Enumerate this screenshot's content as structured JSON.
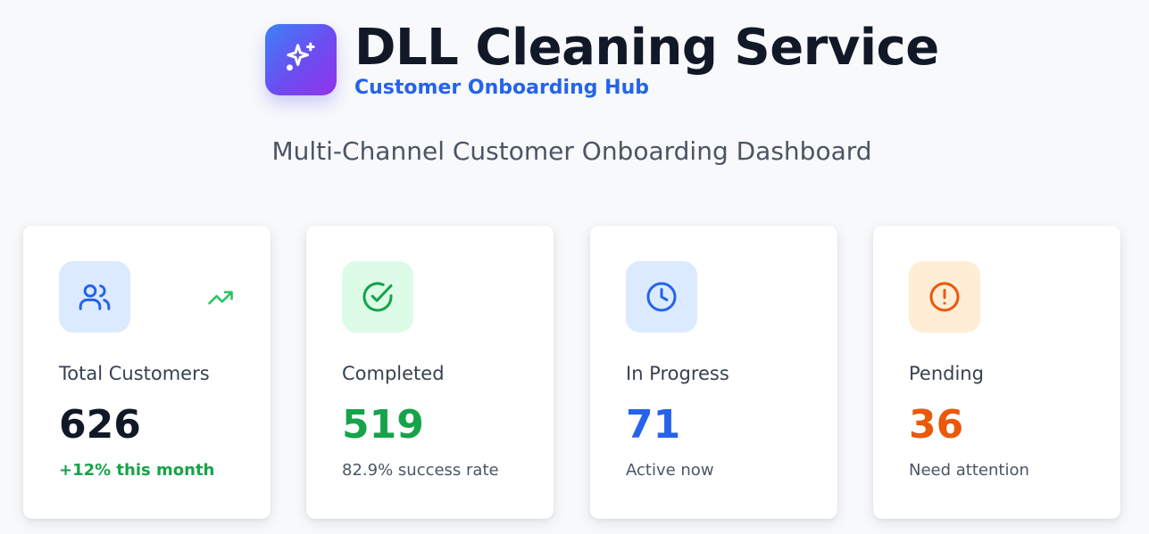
{
  "header": {
    "title": "DLL Cleaning Service",
    "subtitle": "Customer Onboarding Hub",
    "logo_icon": "sparkles-icon"
  },
  "page": {
    "heading": "Multi-Channel Customer Onboarding Dashboard"
  },
  "stats": [
    {
      "label": "Total Customers",
      "value": "626",
      "note": "+12% this month",
      "icon": "users-icon",
      "trend_icon": "trending-up-icon",
      "accent": "#2563eb",
      "icon_bg": "#dbeafe",
      "value_color": "#111827",
      "note_color": "#16a34a"
    },
    {
      "label": "Completed",
      "value": "519",
      "note": "82.9% success rate",
      "icon": "check-circle-icon",
      "accent": "#16a34a",
      "icon_bg": "#dcfce7",
      "value_color": "#16a34a"
    },
    {
      "label": "In Progress",
      "value": "71",
      "note": "Active now",
      "icon": "clock-icon",
      "accent": "#2563eb",
      "icon_bg": "#dbeafe",
      "value_color": "#2563eb"
    },
    {
      "label": "Pending",
      "value": "36",
      "note": "Need attention",
      "icon": "alert-circle-icon",
      "accent": "#ea580c",
      "icon_bg": "#ffedd5",
      "value_color": "#ea580c"
    }
  ]
}
